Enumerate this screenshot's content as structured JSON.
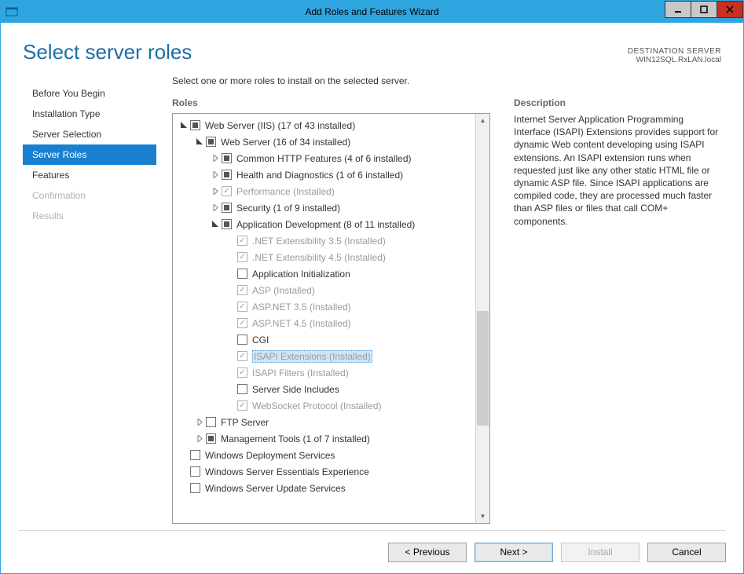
{
  "window": {
    "title": "Add Roles and Features Wizard"
  },
  "header": {
    "page_title": "Select server roles",
    "dest_label": "DESTINATION SERVER",
    "dest_value": "WIN12SQL.RxLAN.local"
  },
  "sidebar": {
    "items": [
      {
        "label": "Before You Begin",
        "state": "normal"
      },
      {
        "label": "Installation Type",
        "state": "normal"
      },
      {
        "label": "Server Selection",
        "state": "normal"
      },
      {
        "label": "Server Roles",
        "state": "selected"
      },
      {
        "label": "Features",
        "state": "normal"
      },
      {
        "label": "Confirmation",
        "state": "disabled"
      },
      {
        "label": "Results",
        "state": "disabled"
      }
    ]
  },
  "main": {
    "instruction": "Select one or more roles to install on the selected server.",
    "roles_heading": "Roles",
    "description_heading": "Description",
    "description_text": "Internet Server Application Programming Interface (ISAPI) Extensions provides support for dynamic Web content developing using ISAPI extensions. An ISAPI extension runs when requested just like any other static HTML file or dynamic ASP file. Since ISAPI applications are compiled code, they are processed much faster than ASP files or files that call COM+ components."
  },
  "tree": [
    {
      "indent": 0,
      "expander": "open",
      "check": "part",
      "label": "Web Server (IIS) (17 of 43 installed)"
    },
    {
      "indent": 1,
      "expander": "open",
      "check": "part",
      "label": "Web Server (16 of 34 installed)"
    },
    {
      "indent": 2,
      "expander": "closed",
      "check": "part",
      "label": "Common HTTP Features (4 of 6 installed)"
    },
    {
      "indent": 2,
      "expander": "closed",
      "check": "part",
      "label": "Health and Diagnostics (1 of 6 installed)"
    },
    {
      "indent": 2,
      "expander": "closed",
      "check": "checked",
      "grey": true,
      "label": "Performance (Installed)"
    },
    {
      "indent": 2,
      "expander": "closed",
      "check": "part",
      "label": "Security (1 of 9 installed)"
    },
    {
      "indent": 2,
      "expander": "open",
      "check": "part",
      "label": "Application Development (8 of 11 installed)"
    },
    {
      "indent": 3,
      "expander": "none",
      "check": "checked",
      "grey": true,
      "label": ".NET Extensibility 3.5 (Installed)"
    },
    {
      "indent": 3,
      "expander": "none",
      "check": "checked",
      "grey": true,
      "label": ".NET Extensibility 4.5 (Installed)"
    },
    {
      "indent": 3,
      "expander": "none",
      "check": "none",
      "label": "Application Initialization"
    },
    {
      "indent": 3,
      "expander": "none",
      "check": "checked",
      "grey": true,
      "label": "ASP (Installed)"
    },
    {
      "indent": 3,
      "expander": "none",
      "check": "checked",
      "grey": true,
      "label": "ASP.NET 3.5 (Installed)"
    },
    {
      "indent": 3,
      "expander": "none",
      "check": "checked",
      "grey": true,
      "label": "ASP.NET 4.5 (Installed)"
    },
    {
      "indent": 3,
      "expander": "none",
      "check": "none",
      "label": "CGI"
    },
    {
      "indent": 3,
      "expander": "none",
      "check": "checked",
      "grey": true,
      "selected": true,
      "label": "ISAPI Extensions (Installed)"
    },
    {
      "indent": 3,
      "expander": "none",
      "check": "checked",
      "grey": true,
      "label": "ISAPI Filters (Installed)"
    },
    {
      "indent": 3,
      "expander": "none",
      "check": "none",
      "label": "Server Side Includes"
    },
    {
      "indent": 3,
      "expander": "none",
      "check": "checked",
      "grey": true,
      "label": "WebSocket Protocol (Installed)"
    },
    {
      "indent": 1,
      "expander": "closed",
      "check": "none",
      "label": "FTP Server"
    },
    {
      "indent": 1,
      "expander": "closed",
      "check": "part",
      "label": "Management Tools (1 of 7 installed)"
    },
    {
      "indent": 0,
      "expander": "none",
      "check": "none",
      "label": "Windows Deployment Services"
    },
    {
      "indent": 0,
      "expander": "none",
      "check": "none",
      "label": "Windows Server Essentials Experience"
    },
    {
      "indent": 0,
      "expander": "none",
      "check": "none",
      "label": "Windows Server Update Services"
    }
  ],
  "footer": {
    "previous": "< Previous",
    "next": "Next >",
    "install": "Install",
    "cancel": "Cancel"
  }
}
